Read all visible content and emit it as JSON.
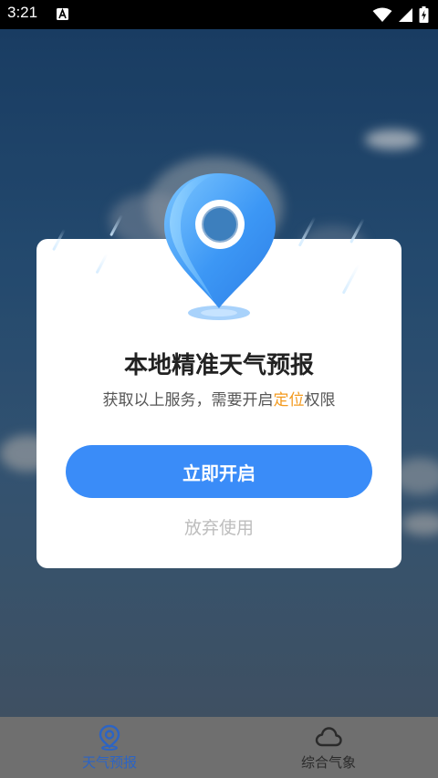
{
  "status_bar": {
    "time": "3:21",
    "notification_icon": "a-letter-icon",
    "icons": [
      "wifi-icon",
      "signal-icon",
      "battery-charging-icon"
    ]
  },
  "dialog": {
    "title": "本地精准天气预报",
    "subtitle_prefix": "获取以上服务，需要开启",
    "subtitle_highlight": "定位",
    "subtitle_suffix": "权限",
    "primary_button": "立即开启",
    "secondary_link": "放弃使用",
    "colors": {
      "accent": "#3a8cf8",
      "highlight": "#f39a1e"
    }
  },
  "bottom_nav": {
    "items": [
      {
        "label": "天气预报",
        "icon": "location-pin-icon",
        "active": true
      },
      {
        "label": "综合气象",
        "icon": "cloud-icon",
        "active": false
      }
    ]
  }
}
